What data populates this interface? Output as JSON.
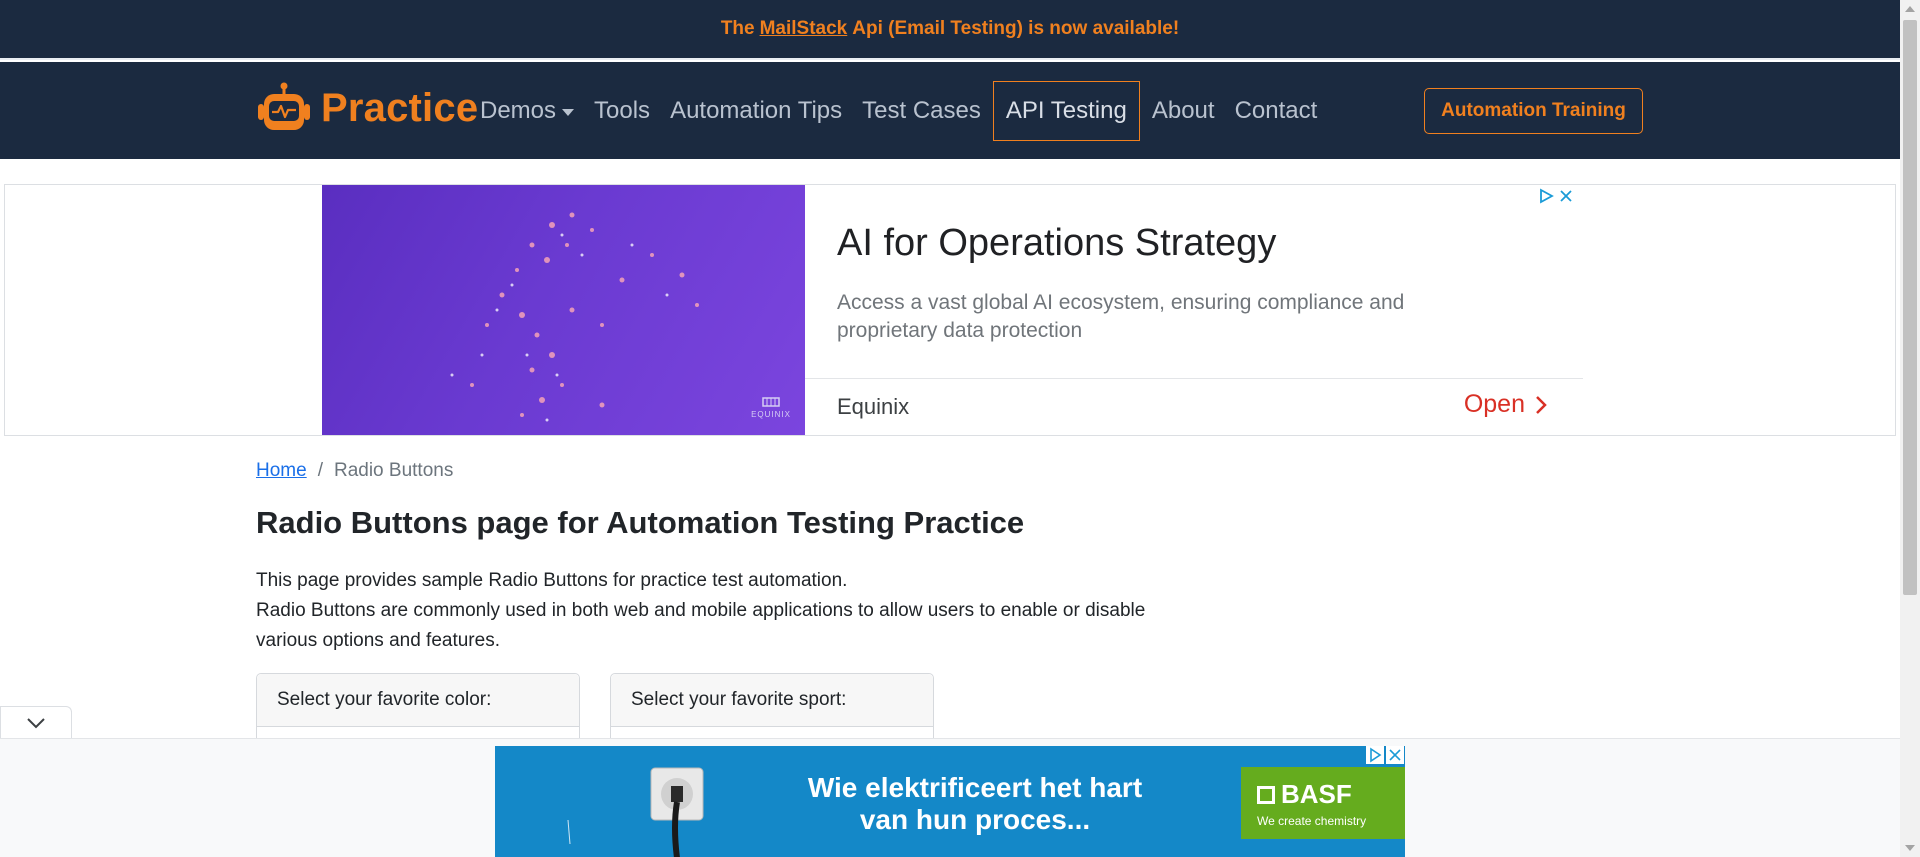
{
  "announcement": {
    "prefix": "The",
    "link": "MailStack",
    "suffix": "Api (Email Testing) is now available!"
  },
  "navbar": {
    "brand": "Practice",
    "links": [
      {
        "label": "Demos"
      },
      {
        "label": "Tools"
      },
      {
        "label": "Automation Tips"
      },
      {
        "label": "Test Cases"
      },
      {
        "label": "API Testing"
      },
      {
        "label": "About"
      },
      {
        "label": "Contact"
      }
    ],
    "training_button": "Automation Training"
  },
  "ad_top": {
    "title": "AI for Operations Strategy",
    "description": "Access a vast global AI ecosystem, ensuring compliance and proprietary data protection",
    "advertiser": "Equinix",
    "cta": "Open",
    "image_mark": "EQUINIX"
  },
  "breadcrumb": {
    "home": "Home",
    "separator": "/",
    "current": "Radio Buttons"
  },
  "page": {
    "title": "Radio Buttons page for Automation Testing Practice",
    "intro_line1": "This page provides sample Radio Buttons for practice test automation.",
    "intro_line2": "Radio Buttons are commonly used in both web and mobile applications to allow users to enable or disable various options and features."
  },
  "cards": {
    "color_header": "Select your favorite color:",
    "sport_header": "Select your favorite sport:"
  },
  "ad_bottom": {
    "headline": "Wie elektrificeert het hart van hun proces...",
    "brand": "BASF",
    "tagline": "We create chemistry"
  },
  "colors": {
    "navy": "#1b2a40",
    "accent_orange": "#f0801f",
    "link_blue": "#1a6fe8",
    "ad_red": "#d93025",
    "basf_green": "#65ac1e",
    "ad_blue": "#1488c8"
  }
}
